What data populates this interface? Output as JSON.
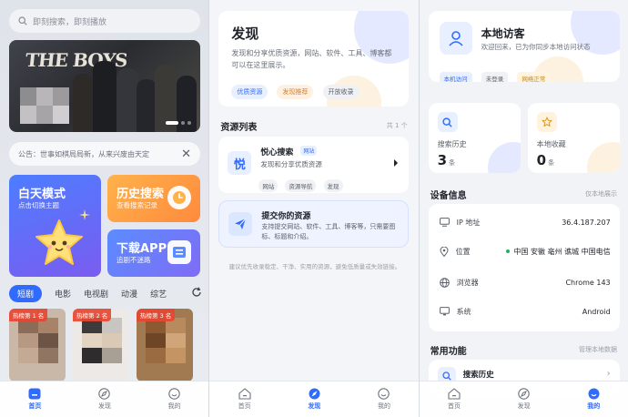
{
  "home": {
    "search_placeholder": "即刻搜索，即刻播放",
    "banner_title": "THE BOYS",
    "notice": "公告：世事如棋局局新，从来兴废由天定",
    "tiles": {
      "day_title": "白天模式",
      "day_sub": "点击切换主题",
      "history_title": "历史搜索",
      "history_sub": "查看搜索记录",
      "app_title": "下载APP",
      "app_sub": "追剧不迷路"
    },
    "categories": [
      "短剧",
      "电影",
      "电视剧",
      "动漫",
      "综艺"
    ],
    "posters": [
      {
        "rank": "热榜第 1 名"
      },
      {
        "rank": "热榜第 2 名"
      },
      {
        "rank": "热榜第 3 名"
      }
    ]
  },
  "discover": {
    "title": "发现",
    "desc": "发现和分享优质资源，网站、软件、工具、博客都可以在这里展示。",
    "chips": [
      "优质资源",
      "发现推荐",
      "开放收录"
    ],
    "list_title": "资源列表",
    "list_count": "共 1 个",
    "resource": {
      "icon_char": "悦",
      "name": "悦心搜索",
      "tag": "网站",
      "desc": "发现和分享优质资源",
      "chips": [
        "网站",
        "资源导航",
        "发现"
      ]
    },
    "submit": {
      "title": "提交你的资源",
      "desc": "支持提交网站、软件、工具、博客等，只需要图标、标题和介绍。"
    },
    "hint": "建议优先收录稳定、干净、实用的资源，避免低质量或失效链接。"
  },
  "profile": {
    "visitor_name": "本地访客",
    "visitor_desc": "欢迎回来，已为你同步本地访问状态",
    "chips": [
      "本机访问",
      "未登录",
      "网络正常"
    ],
    "stats": [
      {
        "label": "搜索历史",
        "value": "3",
        "unit": "条"
      },
      {
        "label": "本地收藏",
        "value": "0",
        "unit": "条"
      }
    ],
    "device_title": "设备信息",
    "device_note": "仅本地展示",
    "device_rows": [
      {
        "icon": "monitor-icon",
        "label": "IP 地址",
        "value": "36.4.187.207"
      },
      {
        "icon": "location-icon",
        "label": "位置",
        "value": "中国 安徽 亳州 谯城 中国电信"
      },
      {
        "icon": "globe-icon",
        "label": "浏览器",
        "value": "Chrome 143"
      },
      {
        "icon": "device-icon",
        "label": "系统",
        "value": "Android"
      }
    ],
    "func_title": "常用功能",
    "func_note": "管理本地数据",
    "func_item": "搜索历史"
  },
  "nav": {
    "home": "首页",
    "discover": "发现",
    "mine": "我的"
  },
  "colors": {
    "accent": "#2f6bff",
    "orange": "#ff8a3d",
    "green": "#22b05e"
  }
}
